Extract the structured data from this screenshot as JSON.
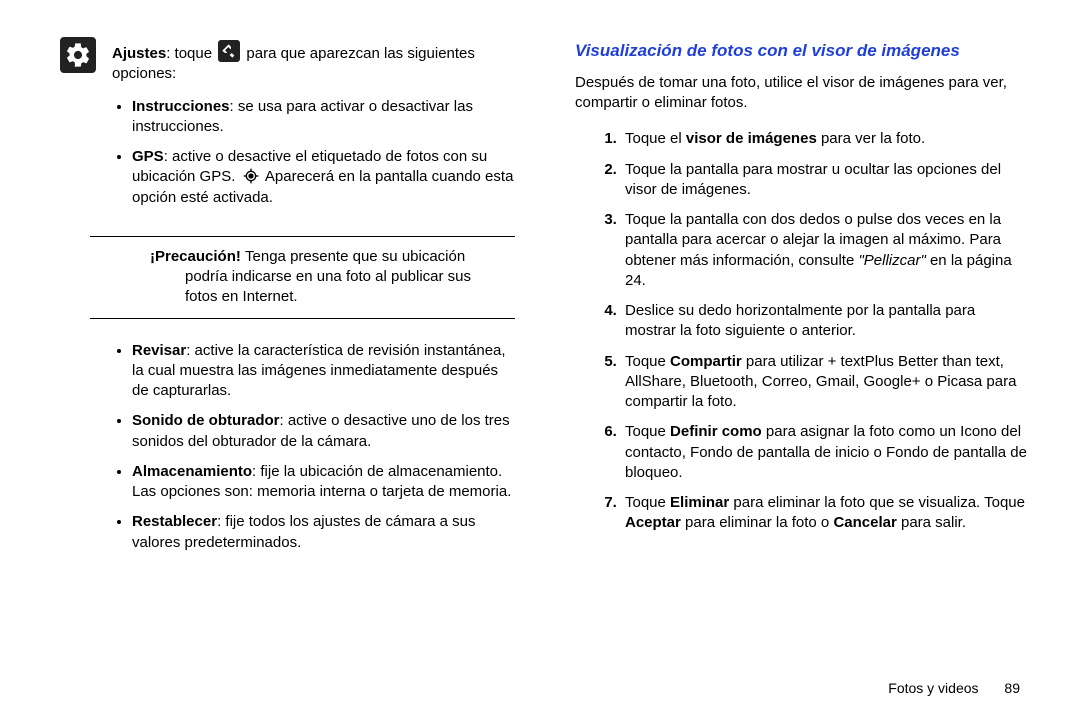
{
  "left": {
    "ajustes_label": "Ajustes",
    "ajustes_pre": ": toque ",
    "ajustes_post": " para que aparezcan las siguientes opciones:",
    "bullets1": [
      {
        "term": "Instrucciones",
        "desc": ": se usa para activar o desactivar las instrucciones."
      }
    ],
    "gps_term": "GPS",
    "gps_pre": ": active o desactive el etiquetado de fotos con su ubicación GPS. ",
    "gps_post": " Aparecerá en la pantalla cuando esta opción esté activada.",
    "caution_label": "¡Precaución! ",
    "caution_text": "Tenga presente que su ubicación podría indicarse en una foto al publicar sus fotos en Internet.",
    "bullets2": [
      {
        "term": "Revisar",
        "desc": ": active la característica de revisión instantánea, la cual muestra las imágenes inmediatamente después de capturarlas."
      },
      {
        "term": "Sonido de obturador",
        "desc": ": active o desactive uno de los tres sonidos del obturador de la cámara."
      },
      {
        "term": "Almacenamiento",
        "desc": ": fije la ubicación de almacenamiento. Las opciones son: memoria interna o tarjeta de memoria."
      },
      {
        "term": "Restablecer",
        "desc": ": fije todos los ajustes de cámara a sus valores predeterminados."
      }
    ]
  },
  "right": {
    "title": "Visualización de fotos con el visor de imágenes",
    "intro": "Después de tomar una foto, utilice el visor de imágenes para ver, compartir o eliminar fotos.",
    "steps": [
      {
        "pre": "Toque el ",
        "bold": "visor de imágenes",
        "post": " para ver la foto."
      },
      {
        "text": "Toque la pantalla para mostrar u ocultar las opciones del visor de imágenes."
      },
      {
        "pre": "Toque la pantalla con dos dedos o pulse dos veces en la pantalla para acercar o alejar la imagen al máximo. Para obtener más información, consulte ",
        "ital": "\"Pellizcar\"",
        "post": " en la página 24."
      },
      {
        "text": "Deslice su dedo horizontalmente por la pantalla para mostrar la foto siguiente o anterior."
      },
      {
        "pre": "Toque ",
        "bold": "Compartir",
        "post": " para utilizar + textPlus Better than text, AllShare, Bluetooth, Correo, Gmail, Google+ o Picasa para compartir la foto."
      },
      {
        "pre": "Toque ",
        "bold": "Definir como",
        "post": " para asignar la foto como un Icono del contacto, Fondo de pantalla de inicio o Fondo de pantalla de bloqueo."
      },
      {
        "pre": "Toque ",
        "bold": "Eliminar",
        "post": " para eliminar la foto que se visualiza. ",
        "second_pre": "Toque ",
        "second_bold": "Aceptar",
        "second_mid": " para eliminar la foto o ",
        "second_bold2": "Cancelar",
        "second_post": " para salir."
      }
    ]
  },
  "footer": {
    "section": "Fotos y videos",
    "page": "89"
  }
}
